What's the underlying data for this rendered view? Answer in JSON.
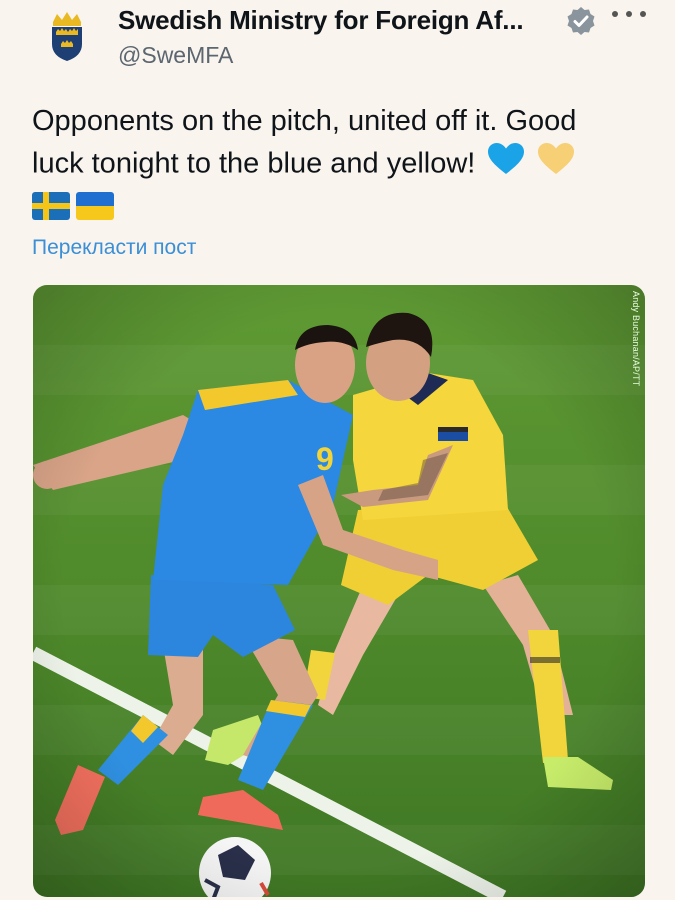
{
  "account": {
    "name": "Swedish Ministry for Foreign Af...",
    "handle": "@SweMFA",
    "avatar_icon": "swedish-coat-of-arms-icon",
    "verified_icon": "verified-badge-icon",
    "more_icon": "more-options-icon"
  },
  "tweet": {
    "line1": "Opponents on the pitch, united off it. Good",
    "line2": "luck tonight to the blue and yellow!",
    "emojis": [
      "blue-heart-icon",
      "yellow-heart-icon",
      "sweden-flag-icon",
      "ukraine-flag-icon"
    ],
    "translate_label": "Перекласти пост"
  },
  "media": {
    "credit": "Andy Buchanan/AP/TT",
    "description_icon": "football-match-photo",
    "shirt_number": "9"
  },
  "colors": {
    "background": "#faf4ef",
    "link": "#3a8fd6",
    "pitch": "#4d8a2c",
    "ukraine_blue": "#1f78d6",
    "sweden_yellow": "#f2d53c"
  }
}
